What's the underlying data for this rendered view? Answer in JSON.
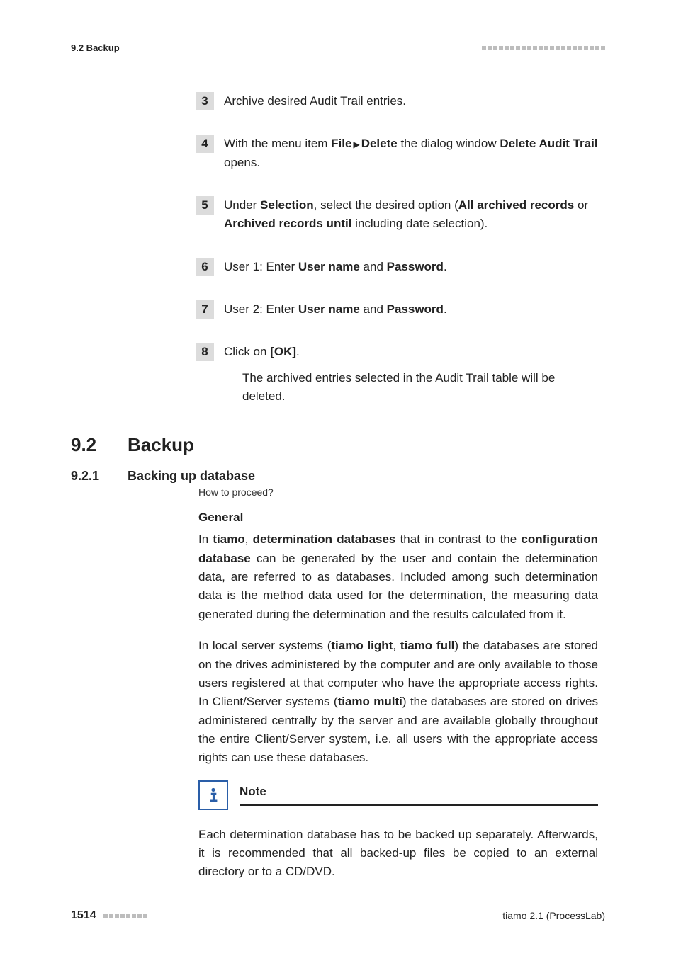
{
  "header": {
    "section_ref": "9.2 Backup"
  },
  "steps": {
    "s3": {
      "num": "3",
      "text": "Archive desired Audit Trail entries."
    },
    "s4": {
      "num": "4",
      "prefix": "With the menu item ",
      "file": "File",
      "delete": "Delete",
      "mid": " the dialog window ",
      "dialog": "Delete Audit Trail",
      "suffix": " opens."
    },
    "s5": {
      "num": "5",
      "prefix": "Under ",
      "selection": "Selection",
      "mid": ", select the desired option (",
      "opt1": "All archived records",
      "or": " or ",
      "opt2": "Archived records until",
      "suffix": " including date selection)."
    },
    "s6": {
      "num": "6",
      "prefix": "User 1: Enter ",
      "user": "User name",
      "and": " and ",
      "pass": "Password",
      "dot": "."
    },
    "s7": {
      "num": "7",
      "prefix": "User 2: Enter ",
      "user": "User name",
      "and": " and ",
      "pass": "Password",
      "dot": "."
    },
    "s8": {
      "num": "8",
      "prefix": "Click on ",
      "ok": "[OK]",
      "dot": ".",
      "result": "The archived entries selected in the Audit Trail table will be deleted."
    }
  },
  "section": {
    "num": "9.2",
    "title": "Backup"
  },
  "subsection": {
    "num": "9.2.1",
    "title": "Backing up database"
  },
  "subsub": "How to proceed?",
  "general_heading": "General",
  "para1": {
    "p1": "In ",
    "tiamo": "tiamo",
    "p2": ", ",
    "dd": "determination databases",
    "p3": " that in contrast to the ",
    "cd": "configuration database",
    "p4": " can be generated by the user and contain the determination data, are referred to as databases. Included among such determination data is the method data used for the determination, the measuring data generated during the determination and the results calculated from it."
  },
  "para2": {
    "p1": "In local server systems (",
    "tl": "tiamo light",
    "p2": ", ",
    "tf": "tiamo full",
    "p3": ") the databases are stored on the drives administered by the computer and are only available to those users registered at that computer who have the appropriate access rights. In Client/Server systems (",
    "tm": "tiamo multi",
    "p4": ") the databases are stored on drives administered centrally by the server and are available globally throughout the entire Client/Server system, i.e. all users with the appropriate access rights can use these databases."
  },
  "note": {
    "label": "Note",
    "body": "Each determination database has to be backed up separately. Afterwards, it is recommended that all backed-up files be copied to an external directory or to a CD/DVD."
  },
  "footer": {
    "page": "1514",
    "product": "tiamo 2.1 (ProcessLab)"
  }
}
